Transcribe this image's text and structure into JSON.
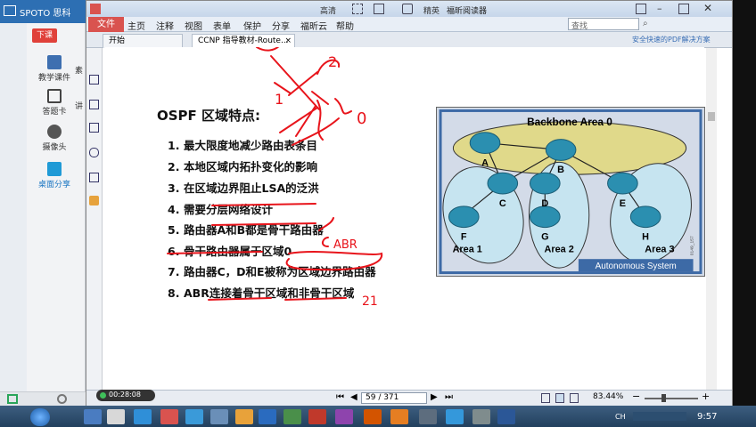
{
  "outer_app": {
    "title": "SPOTO 思科",
    "class_button": "下课",
    "sidebar": [
      {
        "label": "教学课件",
        "icon": "courseware-icon"
      },
      {
        "label": "答题卡",
        "icon": "answer-card-icon"
      },
      {
        "label": "摄像头",
        "icon": "camera-icon"
      },
      {
        "label": "桌面分享",
        "icon": "desktop-share-icon"
      }
    ],
    "partial_labels": {
      "a": "素",
      "b": "讲"
    },
    "timer": "00:28:08"
  },
  "reader": {
    "title_buttons": [
      "高清",
      "精英"
    ],
    "window_title": "福昕阅读器",
    "menu": [
      "文件",
      "主页",
      "注释",
      "视图",
      "表单",
      "保护",
      "分享",
      "福昕云",
      "帮助"
    ],
    "search_placeholder": "查找",
    "promo": "安全快速的PDF解决方案",
    "tabs": [
      "开始",
      "CCNP 指导教材-Route..."
    ],
    "page_indicator": "59 / 371",
    "zoom": "83.44%"
  },
  "slide": {
    "title": "OSPF 区域特点:",
    "points": [
      {
        "n": "1.",
        "text": "最大限度地减少路由表条目"
      },
      {
        "n": "2.",
        "text": "本地区域内拓扑变化的影响"
      },
      {
        "n": "3.",
        "text": "在区域边界阻止LSA的泛洪"
      },
      {
        "n": "4.",
        "text": "需要分层网络设计"
      },
      {
        "n": "5.",
        "text": "路由器A和B都是骨干路由器"
      },
      {
        "n": "6.",
        "text": "骨干路由器属于区域0"
      },
      {
        "n": "7.",
        "text": "路由器C，D和E被称为区域边界路由器"
      },
      {
        "n": "8.",
        "text": "ABR连接着骨干区域和非骨干区域"
      }
    ],
    "annotations": {
      "top_2": "2",
      "left_1": "1",
      "right_0": "0",
      "abr": "ABR",
      "num_21": "21"
    },
    "diagram": {
      "backbone_label": "Backbone Area 0",
      "routers": [
        "A",
        "B",
        "C",
        "D",
        "E",
        "F",
        "G",
        "H"
      ],
      "areas": [
        "Area 1",
        "Area 2",
        "Area 3"
      ],
      "system_label": "Autonomous System",
      "figure_id": "0149_157"
    }
  },
  "taskbar": {
    "tray_lang": "CH",
    "time": "9:57"
  },
  "colors": {
    "ink": "#e8141b",
    "router": "#2b8fb0",
    "backbone": "#e0d98a",
    "area": "#c6e4f0"
  }
}
